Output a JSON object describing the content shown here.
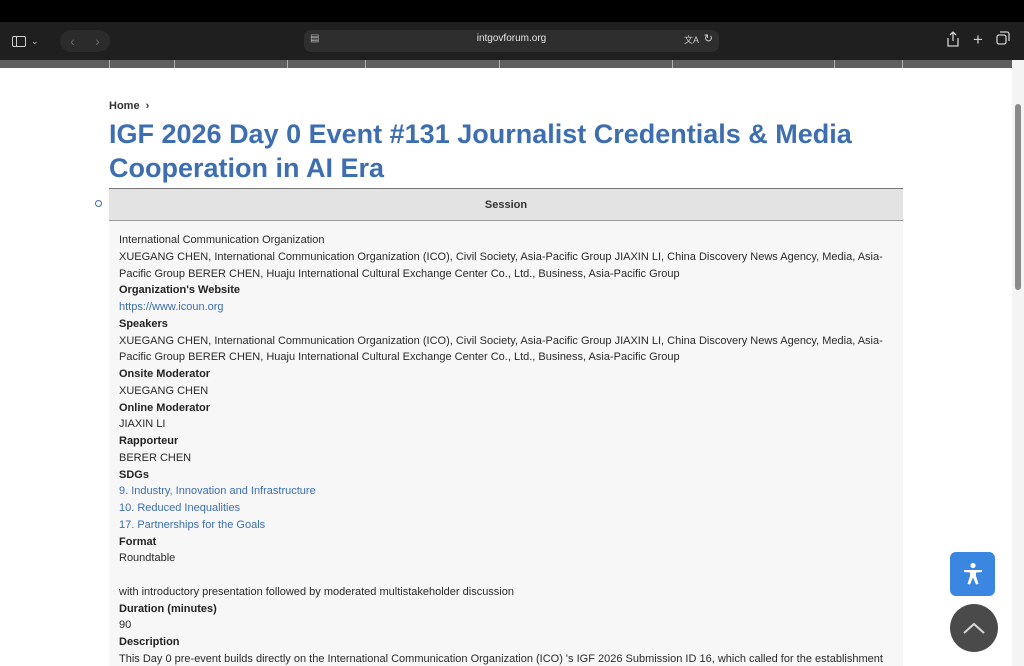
{
  "browser": {
    "url": "intgovforum.org",
    "icons": [
      "sidebar-icon",
      "back-icon",
      "forward-icon",
      "page-icon",
      "translate-icon",
      "reload-icon",
      "share-icon",
      "plus-icon",
      "tabs-icon"
    ]
  },
  "breadcrumb": {
    "home": "Home"
  },
  "page": {
    "title": "IGF 2026 Day 0 Event #131 Journalist Credentials & Media Cooperation in AI Era"
  },
  "session": {
    "header": "Session",
    "organizer_name": "International Communication Organization",
    "organizer_line": "XUEGANG CHEN, International Communication Organization (ICO), Civil Society, Asia-Pacific Group JIAXIN LI, China Discovery News Agency, Media, Asia-Pacific Group BERER CHEN, Huaju International Cultural Exchange Center Co., Ltd., Business, Asia-Pacific Group",
    "website_label": "Organization's Website",
    "website": "https://www.icoun.org",
    "speakers_label": "Speakers",
    "speakers": "XUEGANG CHEN, International Communication Organization (ICO), Civil Society, Asia-Pacific Group JIAXIN LI, China Discovery News Agency, Media, Asia-Pacific Group BERER CHEN, Huaju International Cultural Exchange Center Co., Ltd., Business, Asia-Pacific Group",
    "onsite_moderator_label": "Onsite Moderator",
    "onsite_moderator": "XUEGANG CHEN",
    "online_moderator_label": "Online Moderator",
    "online_moderator": "JIAXIN LI",
    "rapporteur_label": "Rapporteur",
    "rapporteur": "BERER CHEN",
    "sdgs_label": "SDGs",
    "sdgs": [
      "9. Industry, Innovation and Infrastructure",
      "10. Reduced Inequalities",
      "17. Partnerships for the Goals"
    ],
    "format_label": "Format",
    "format": "Roundtable",
    "format_note": "with introductory presentation followed by moderated multistakeholder discussion",
    "duration_label": "Duration (minutes)",
    "duration": "90",
    "description_label": "Description",
    "description": "This Day 0 pre-event builds directly on the International Communication Organization (ICO) 's IGF 2026 Submission ID 16, which called for the establishment"
  },
  "colors": {
    "accent": "#3d6fb0",
    "a11y_button": "#3a86e0",
    "top_button": "#4a4a4a"
  }
}
